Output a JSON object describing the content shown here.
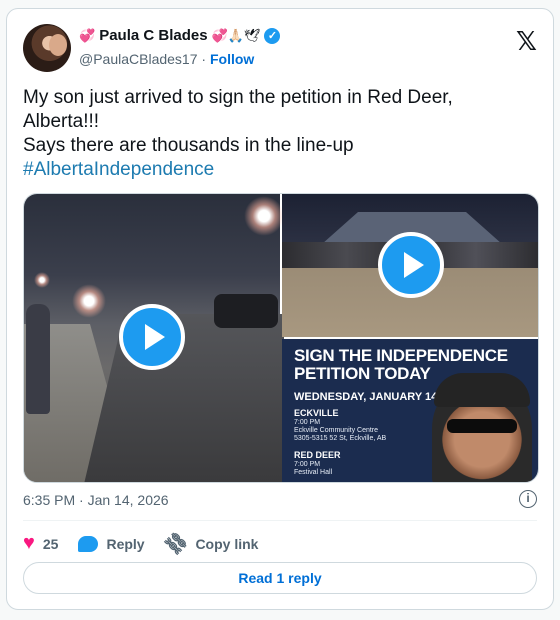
{
  "author": {
    "name": "Paula C Blades",
    "name_emoji_left": "💞",
    "name_emoji_right": "💞🙏🏻🕊",
    "handle": "@PaulaCBlades17",
    "separator": "·",
    "follow_label": "Follow",
    "verified_icon": "verified-check-icon"
  },
  "tweet": {
    "line1": "My son just arrived to sign the petition in Red Deer, Alberta!!!",
    "line2": "Says there are thousands in the line-up",
    "hashtag": "#AlbertaIndependence"
  },
  "media": {
    "poster": {
      "title_line1": "SIGN THE INDEPENDENCE",
      "title_line2": "PETITION TODAY",
      "date": "WEDNESDAY, JANUARY 14",
      "loc1_name": "ECKVILLE",
      "loc1_time": "7:00 PM",
      "loc1_venue": "Eckville Community Centre",
      "loc1_address": "5305-5315 52 St, Eckville, AB",
      "loc2_name": "RED DEER",
      "loc2_time": "7:00 PM",
      "loc2_venue": "Festival Hall"
    }
  },
  "meta": {
    "time": "6:35 PM",
    "separator": "·",
    "date": "Jan 14, 2026"
  },
  "actions": {
    "likes": "25",
    "reply_label": "Reply",
    "copy_link_label": "Copy link",
    "read_replies_label": "Read 1 reply"
  },
  "colors": {
    "accent": "#1d9bf0",
    "like": "#f91880",
    "link": "#006fd6"
  }
}
